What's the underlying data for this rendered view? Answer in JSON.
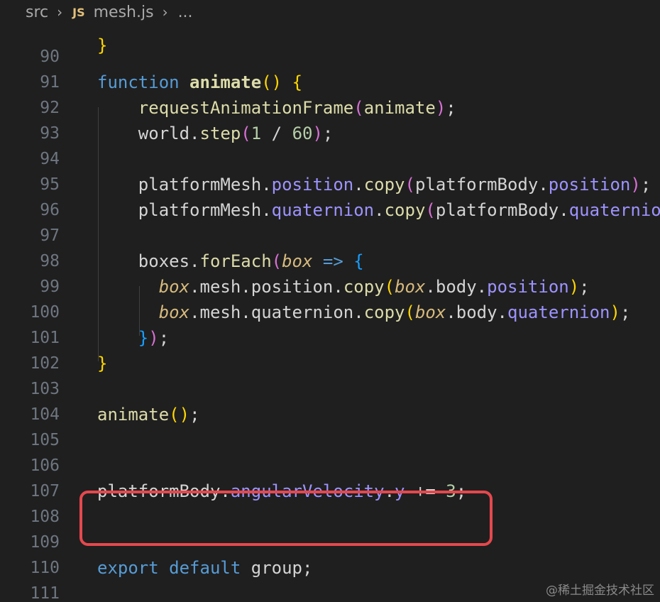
{
  "breadcrumb": {
    "folder": "src",
    "file_icon": "JS",
    "file": "mesh.js",
    "more": "..."
  },
  "lines": [
    {
      "n": "90",
      "tokens": []
    },
    {
      "n": "91",
      "tokens": [
        [
          "kw",
          "function"
        ],
        [
          "var",
          " "
        ],
        [
          "fnb",
          "animate"
        ],
        [
          "b1",
          "()"
        ],
        [
          "var",
          " "
        ],
        [
          "b1",
          "{"
        ]
      ]
    },
    {
      "n": "92",
      "tokens": [
        [
          "var",
          "    "
        ],
        [
          "fn",
          "requestAnimationFrame"
        ],
        [
          "b2",
          "("
        ],
        [
          "fn",
          "animate"
        ],
        [
          "b2",
          ")"
        ],
        [
          "var",
          ";"
        ]
      ]
    },
    {
      "n": "93",
      "tokens": [
        [
          "var",
          "    world."
        ],
        [
          "fn",
          "step"
        ],
        [
          "b2",
          "("
        ],
        [
          "num",
          "1"
        ],
        [
          "var",
          " / "
        ],
        [
          "num",
          "60"
        ],
        [
          "b2",
          ")"
        ],
        [
          "var",
          ";"
        ]
      ]
    },
    {
      "n": "94",
      "tokens": []
    },
    {
      "n": "95",
      "tokens": [
        [
          "var",
          "    platformMesh."
        ],
        [
          "prop",
          "position"
        ],
        [
          "var",
          "."
        ],
        [
          "fn",
          "copy"
        ],
        [
          "b2",
          "("
        ],
        [
          "var",
          "platformBody."
        ],
        [
          "prop",
          "position"
        ],
        [
          "b2",
          ")"
        ],
        [
          "var",
          ";"
        ]
      ]
    },
    {
      "n": "96",
      "tokens": [
        [
          "var",
          "    platformMesh."
        ],
        [
          "prop",
          "quaternion"
        ],
        [
          "var",
          "."
        ],
        [
          "fn",
          "copy"
        ],
        [
          "b2",
          "("
        ],
        [
          "var",
          "platformBody."
        ],
        [
          "prop",
          "quaternion"
        ]
      ]
    },
    {
      "n": "97",
      "tokens": []
    },
    {
      "n": "98",
      "tokens": [
        [
          "var",
          "    boxes."
        ],
        [
          "fn",
          "forEach"
        ],
        [
          "b2",
          "("
        ],
        [
          "par",
          "box"
        ],
        [
          "var",
          " "
        ],
        [
          "arrow",
          "=>"
        ],
        [
          "var",
          " "
        ],
        [
          "b3",
          "{"
        ]
      ]
    },
    {
      "n": "99",
      "tokens": [
        [
          "var",
          "      "
        ],
        [
          "par",
          "box"
        ],
        [
          "var",
          ".mesh.position."
        ],
        [
          "fn",
          "copy"
        ],
        [
          "b1",
          "("
        ],
        [
          "par",
          "box"
        ],
        [
          "var",
          ".body."
        ],
        [
          "prop",
          "position"
        ],
        [
          "b1",
          ")"
        ],
        [
          "var",
          ";"
        ]
      ]
    },
    {
      "n": "100",
      "tokens": [
        [
          "var",
          "      "
        ],
        [
          "par",
          "box"
        ],
        [
          "var",
          ".mesh.quaternion."
        ],
        [
          "fn",
          "copy"
        ],
        [
          "b1",
          "("
        ],
        [
          "par",
          "box"
        ],
        [
          "var",
          ".body."
        ],
        [
          "prop",
          "quaternion"
        ],
        [
          "b1",
          ")"
        ],
        [
          "var",
          ";"
        ]
      ]
    },
    {
      "n": "101",
      "tokens": [
        [
          "var",
          "    "
        ],
        [
          "b3",
          "}"
        ],
        [
          "b2",
          ")"
        ],
        [
          "var",
          ";"
        ]
      ]
    },
    {
      "n": "102",
      "tokens": [
        [
          "b1",
          "}"
        ]
      ]
    },
    {
      "n": "103",
      "tokens": []
    },
    {
      "n": "104",
      "tokens": [
        [
          "fn",
          "animate"
        ],
        [
          "b1",
          "()"
        ],
        [
          "var",
          ";"
        ]
      ]
    },
    {
      "n": "105",
      "tokens": []
    },
    {
      "n": "106",
      "tokens": []
    },
    {
      "n": "107",
      "tokens": [
        [
          "var",
          "platformBody."
        ],
        [
          "prop",
          "angularVelocity"
        ],
        [
          "var",
          "."
        ],
        [
          "prop",
          "y"
        ],
        [
          "var",
          " += "
        ],
        [
          "num",
          "3"
        ],
        [
          "var",
          ";"
        ]
      ]
    },
    {
      "n": "108",
      "tokens": []
    },
    {
      "n": "109",
      "tokens": []
    },
    {
      "n": "110",
      "tokens": [
        [
          "kw",
          "export"
        ],
        [
          "var",
          " "
        ],
        [
          "kw",
          "default"
        ],
        [
          "var",
          " group;"
        ]
      ]
    },
    {
      "n": "111",
      "tokens": []
    }
  ],
  "watermark": "@稀土掘金技术社区",
  "colors": {
    "background": "#1f1f1f",
    "highlight_border": "#e5484d"
  }
}
